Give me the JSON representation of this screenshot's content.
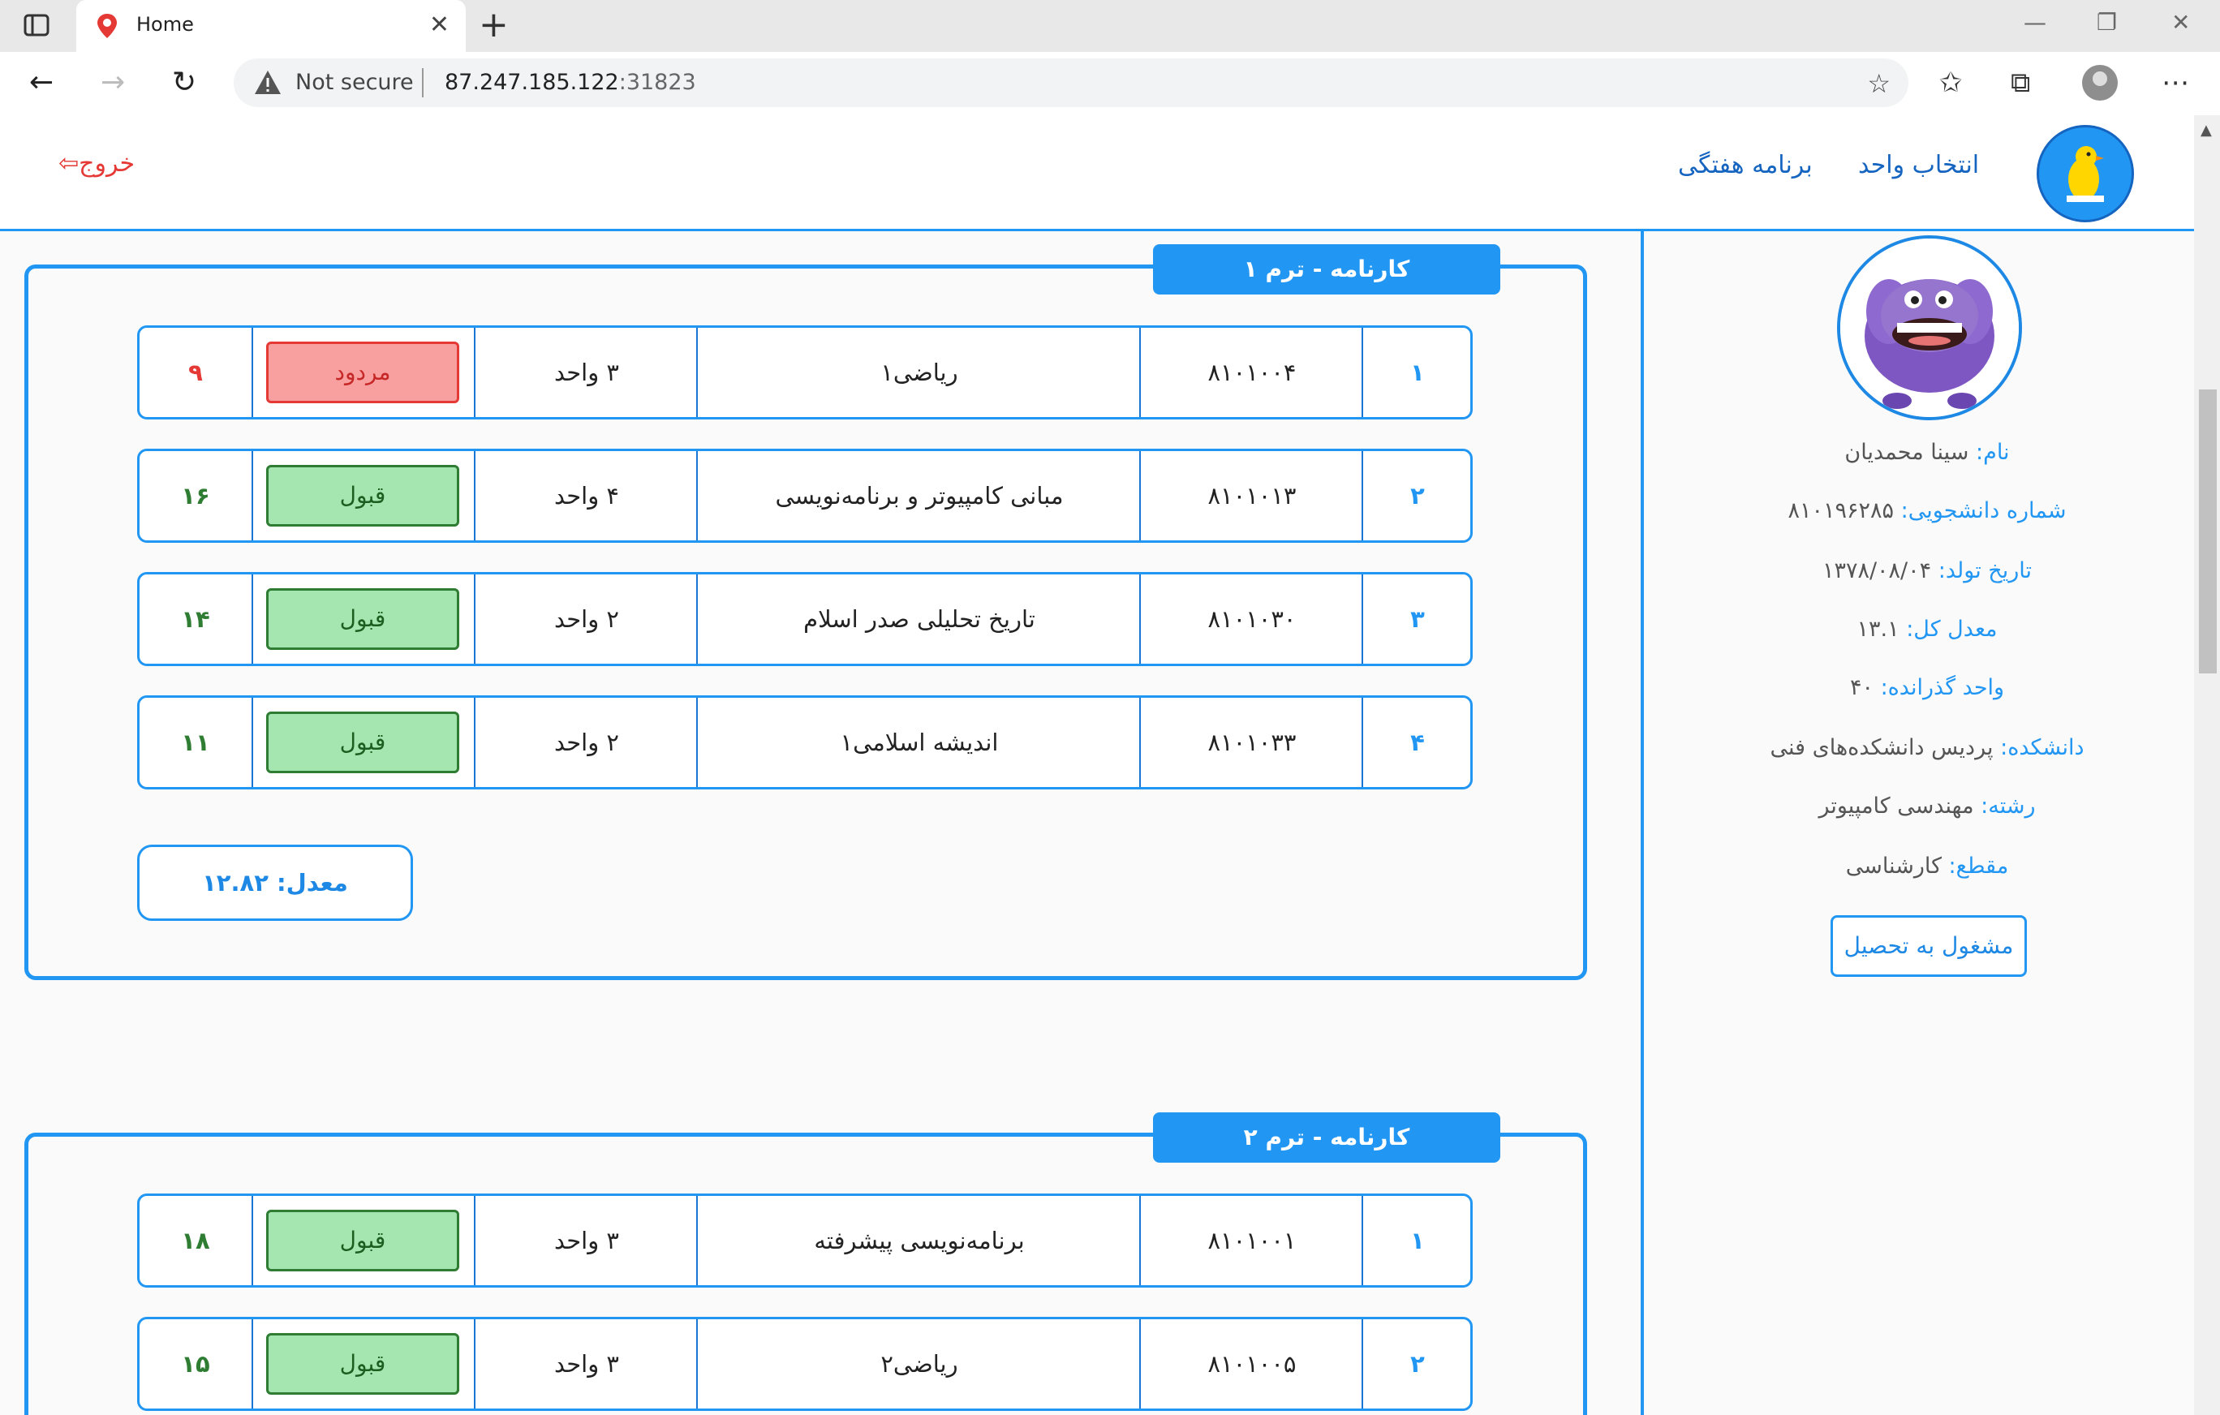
{
  "browser": {
    "tab_title": "Home",
    "tab_close": "✕",
    "new_tab": "+",
    "not_secure": "Not secure",
    "url_host": "87.247.185.122",
    "url_port": ":31823",
    "window_controls": {
      "minimize": "—",
      "restore": "❐",
      "close": "✕"
    }
  },
  "header": {
    "nav": [
      {
        "label": "انتخاب واحد"
      },
      {
        "label": "برنامه هفتگی"
      }
    ],
    "logout": "خروج"
  },
  "profile": {
    "fields": [
      {
        "key": "نام:",
        "value": "سینا محمدیان"
      },
      {
        "key": "شماره دانشجویی:",
        "value": "۸۱۰۱۹۶۲۸۵"
      },
      {
        "key": "تاریخ تولد:",
        "value": "۱۳۷۸/۰۸/۰۴"
      },
      {
        "key": "معدل کل:",
        "value": "۱۳.۱"
      },
      {
        "key": "واحد گذرانده:",
        "value": "۴۰"
      },
      {
        "key": "دانشکده:",
        "value": "پردیس دانشکده‌های فنی"
      },
      {
        "key": "رشته:",
        "value": "مهندسی کامپیوتر"
      },
      {
        "key": "مقطع:",
        "value": "کارشناسی"
      }
    ],
    "status": "مشغول به تحصیل"
  },
  "terms": [
    {
      "title": "کارنامه - ترم ۱",
      "courses": [
        {
          "idx": "۱",
          "code": "۸۱۰۱۰۰۴",
          "name": "ریاضی۱",
          "units": "۳ واحد",
          "status": "مردود",
          "grade": "۹"
        },
        {
          "idx": "۲",
          "code": "۸۱۰۱۰۱۳",
          "name": "مبانی کامپیوتر و برنامه‌نویسی",
          "units": "۴ واحد",
          "status": "قبول",
          "grade": "۱۶"
        },
        {
          "idx": "۳",
          "code": "۸۱۰۱۰۳۰",
          "name": "تاریخ تحلیلی صدر اسلام",
          "units": "۲ واحد",
          "status": "قبول",
          "grade": "۱۴"
        },
        {
          "idx": "۴",
          "code": "۸۱۰۱۰۳۳",
          "name": "اندیشه اسلامی۱",
          "units": "۲ واحد",
          "status": "قبول",
          "grade": "۱۱"
        }
      ],
      "gpa": "معدل: ۱۲.۸۲"
    },
    {
      "title": "کارنامه - ترم ۲",
      "courses": [
        {
          "idx": "۱",
          "code": "۸۱۰۱۰۰۱",
          "name": "برنامه‌نویسی پیشرفته",
          "units": "۳ واحد",
          "status": "قبول",
          "grade": "۱۸"
        },
        {
          "idx": "۲",
          "code": "۸۱۰۱۰۰۵",
          "name": "ریاضی۲",
          "units": "۳ واحد",
          "status": "قبول",
          "grade": "۱۵"
        }
      ]
    }
  ],
  "colors": {
    "accent": "#2196f3",
    "pass": "#2e7d32",
    "fail": "#e53935"
  }
}
